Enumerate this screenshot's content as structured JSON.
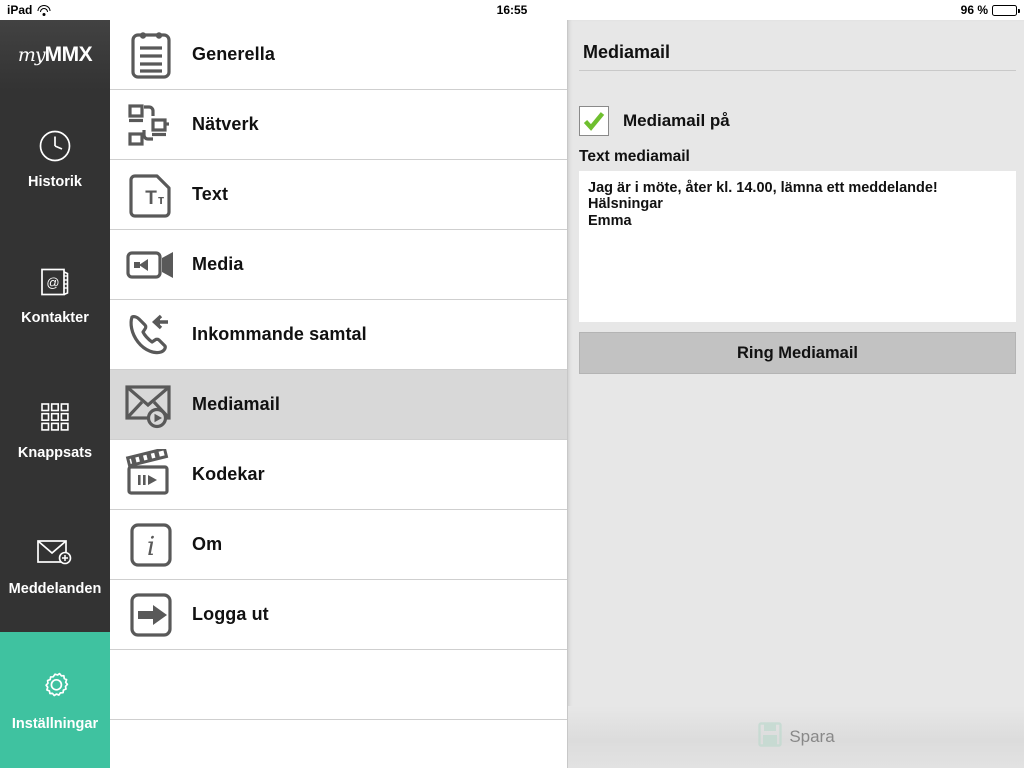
{
  "status_bar": {
    "device": "iPad",
    "wifi_icon": "wifi-icon",
    "time": "16:55",
    "battery_percent": "96 %",
    "battery_icon": "battery-icon"
  },
  "sidebar": {
    "brand_my": "my",
    "brand_mmx": "MMX",
    "active_color": "#3fc2a0",
    "background_color": "#333333",
    "items": [
      {
        "label": "Historik",
        "icon": "clock-icon",
        "active": false
      },
      {
        "label": "Kontakter",
        "icon": "address-book-icon",
        "active": false
      },
      {
        "label": "Knappsats",
        "icon": "keypad-icon",
        "active": false
      },
      {
        "label": "Meddelanden",
        "icon": "envelope-plus-icon",
        "active": false
      },
      {
        "label": "Inställningar",
        "icon": "gear-icon",
        "active": true
      }
    ]
  },
  "settings_list": {
    "selected_background": "#d8d8d8",
    "items": [
      {
        "label": "Generella",
        "icon": "clipboard-icon",
        "selected": false
      },
      {
        "label": "Nätverk",
        "icon": "network-icon",
        "selected": false
      },
      {
        "label": "Text",
        "icon": "text-document-icon",
        "selected": false
      },
      {
        "label": "Media",
        "icon": "video-camera-icon",
        "selected": false
      },
      {
        "label": "Inkommande samtal",
        "icon": "incoming-call-icon",
        "selected": false
      },
      {
        "label": "Mediamail",
        "icon": "mediamail-envelope-play-icon",
        "selected": true
      },
      {
        "label": "Kodekar",
        "icon": "clapperboard-icon",
        "selected": false
      },
      {
        "label": "Om",
        "icon": "info-icon",
        "selected": false
      },
      {
        "label": "Logga ut",
        "icon": "logout-arrow-icon",
        "selected": false
      }
    ]
  },
  "detail": {
    "title": "Mediamail",
    "checkbox": {
      "label": "Mediamail på",
      "checked": true,
      "check_color": "#6fbf2f"
    },
    "text_field": {
      "label": "Text mediamail",
      "value": "Jag är i möte, åter kl. 14.00, lämna ett meddelande!\nHälsningar\nEmma",
      "placeholder": ""
    },
    "call_button": {
      "label": "Ring Mediamail",
      "background_color": "#c2c2c2"
    },
    "save_button": {
      "label": "Spara",
      "icon": "save-floppy-icon",
      "icon_color": "#bcd9cd",
      "enabled": false
    }
  }
}
